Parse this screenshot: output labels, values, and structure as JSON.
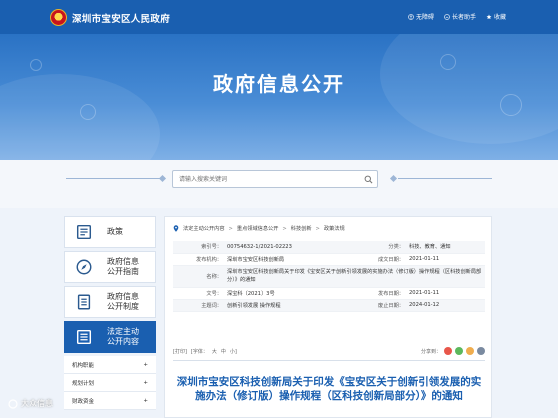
{
  "header": {
    "site_name": "深圳市宝安区人民政府",
    "links": [
      {
        "label": "无障碍",
        "icon": "accessibility-icon"
      },
      {
        "label": "长者助手",
        "icon": "elder-assistant-icon"
      },
      {
        "label": "收藏",
        "icon": "star-icon"
      }
    ]
  },
  "banner": {
    "title": "政府信息公开"
  },
  "search": {
    "placeholder": "请输入搜索关键词",
    "icon": "search-icon"
  },
  "sidebar": {
    "items": [
      {
        "label": "政策",
        "icon": "book-icon"
      },
      {
        "label": "政府信息\n公开指南",
        "icon": "compass-icon"
      },
      {
        "label": "政府信息\n公开制度",
        "icon": "document-list-icon"
      },
      {
        "label": "法定主动\n公开内容",
        "icon": "grid-list-icon",
        "active": true
      }
    ],
    "sub_items": [
      {
        "label": "机构职能"
      },
      {
        "label": "规划计划"
      },
      {
        "label": "财政资金"
      }
    ]
  },
  "breadcrumb": [
    "法定主动公开内容",
    "重点领域信息公开",
    "科技创新",
    "政策法规"
  ],
  "info": {
    "index_label": "索引号：",
    "index_value": "00754632-1/2021-02223",
    "category_label": "分类：",
    "category_value": "科技、教育、通知",
    "publisher_label": "发布机构：",
    "publisher_value": "深圳市宝安区科技创新局",
    "created_label": "成文日期：",
    "created_value": "2021-01-11",
    "name_label": "名称：",
    "name_value": "深圳市宝安区科技创新局关于印发《宝安区关于创新引领发展的实施办法（修订版）操作规程（区科技创新局部分）》的通知",
    "docno_label": "文号：",
    "docno_value": "深宝科〔2021〕3号",
    "published_label": "发布日期：",
    "published_value": "2021-01-11",
    "keywords_label": "主题词：",
    "keywords_value": "创新引领发展 操作规程",
    "expiry_label": "废止日期：",
    "expiry_value": "2024-01-12"
  },
  "toolbar": {
    "print": "[打印]",
    "font_label": "[字体：",
    "font_large": "大",
    "font_mid": "中",
    "font_small": "小]",
    "share_label": "分享到："
  },
  "document": {
    "title": "深圳市宝安区科技创新局关于印发《宝安区关于创新引领发展的实施办法（修订版）操作规程（区科技创新局部分）》的通知"
  },
  "watermark": "大众信息",
  "colors": {
    "primary": "#1a5fb0",
    "banner_top": "#2a72c4",
    "title_blue": "#1a5fb0"
  }
}
